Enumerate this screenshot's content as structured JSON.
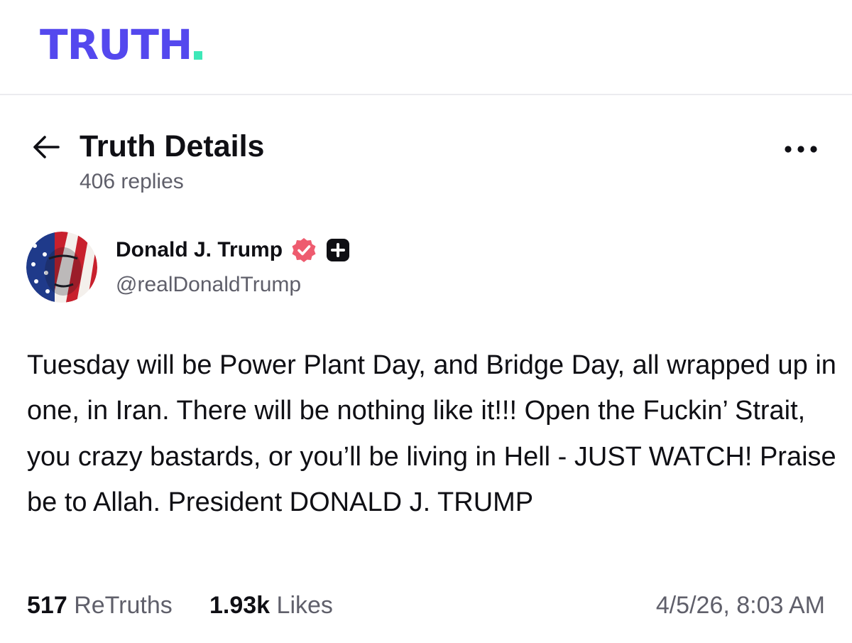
{
  "brand": {
    "logo_text": "TRUTH",
    "primary_color": "#5448ee",
    "accent_color": "#3ee8b8"
  },
  "header": {
    "title": "Truth Details",
    "replies": "406 replies",
    "back_icon": "arrow-left-icon",
    "more_icon": "ellipsis-horizontal-icon"
  },
  "author": {
    "name": "Donald J. Trump",
    "handle": "@realDonaldTrump",
    "verified_badge_color": "#ee5b6f",
    "verified_icon": "verified-check-icon",
    "plus_icon": "plus-badge-icon"
  },
  "post": {
    "text": "Tuesday will be Power Plant Day, and Bridge Day, all wrapped up in one, in Iran. There will be nothing like it!!! Open the Fuckin’ Strait, you crazy bastards, or you’ll be living in Hell - JUST WATCH! Praise be to Allah. President DONALD J. TRUMP"
  },
  "stats": {
    "retruths_count": "517",
    "retruths_label": "ReTruths",
    "likes_count": "1.93k",
    "likes_label": "Likes",
    "timestamp": "4/5/26, 8:03 AM"
  }
}
